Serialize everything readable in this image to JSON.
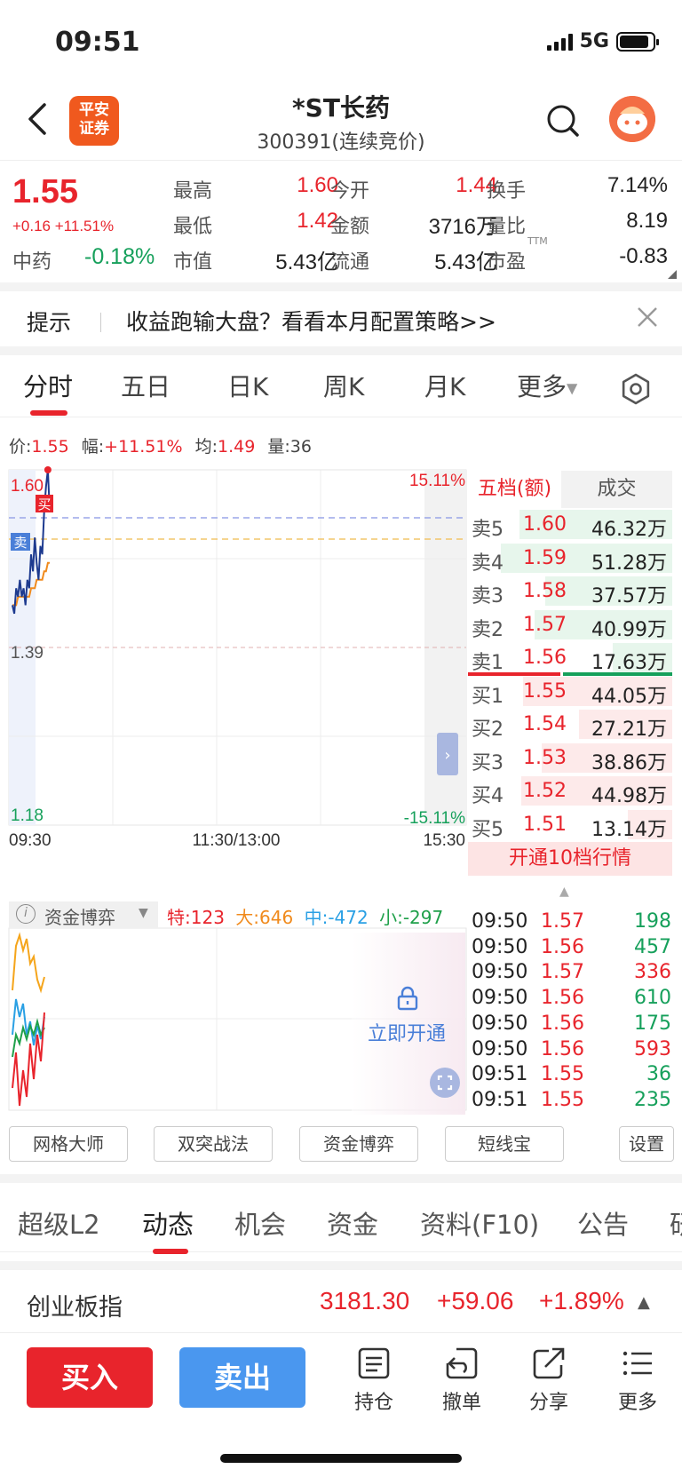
{
  "status_bar": {
    "time": "09:51",
    "network": "5G"
  },
  "header": {
    "broker_logo_line1": "平安",
    "broker_logo_line2": "证券",
    "stock_name": "*ST长药",
    "stock_code": "300391(连续竞价)"
  },
  "quote": {
    "price": "1.55",
    "change": "+0.16 +11.51%",
    "sector_name": "中药",
    "sector_change": "-0.18%",
    "fields": [
      {
        "label": "最高",
        "value": "1.60",
        "color": "red"
      },
      {
        "label": "今开",
        "value": "1.44",
        "color": "red"
      },
      {
        "label": "换手",
        "value": "7.14%",
        "color": "dark"
      },
      {
        "label": "最低",
        "value": "1.42",
        "color": "red"
      },
      {
        "label": "金额",
        "value": "3716万",
        "color": "dark"
      },
      {
        "label": "量比",
        "value": "8.19",
        "color": "dark"
      },
      {
        "label": "市值",
        "value": "5.43亿",
        "color": "dark"
      },
      {
        "label": "流通",
        "value": "5.43亿",
        "color": "dark"
      },
      {
        "label": "市盈",
        "value": "-0.83",
        "color": "dark",
        "sup": "TTM"
      }
    ]
  },
  "tip": {
    "label": "提示",
    "text": "收益跑输大盘？看看本月配置策略>>"
  },
  "chart_tabs": [
    "分时",
    "五日",
    "日K",
    "周K",
    "月K",
    "更多"
  ],
  "info_line": {
    "price_label": "价:",
    "price": "1.55",
    "range_label": "幅:",
    "range": "+11.51%",
    "avg_label": "均:",
    "avg": "1.49",
    "vol_label": "量:",
    "vol": "36"
  },
  "chart_data": {
    "type": "line",
    "y_labels_left": [
      "1.60",
      "1.39",
      "1.18"
    ],
    "y_labels_right": [
      "15.11%",
      "-15.11%"
    ],
    "x_labels": [
      "09:30",
      "11:30/13:00",
      "15:30"
    ],
    "ylim": [
      1.18,
      1.6
    ],
    "series": [
      {
        "name": "价",
        "color": "#1d3a8f",
        "x": [
          0,
          1,
          2,
          3,
          4,
          5,
          6,
          7,
          8,
          9,
          10,
          11,
          12,
          13,
          14,
          15,
          16,
          17,
          18,
          19,
          20
        ],
        "y": [
          1.44,
          1.43,
          1.46,
          1.45,
          1.47,
          1.45,
          1.46,
          1.44,
          1.47,
          1.46,
          1.5,
          1.48,
          1.52,
          1.49,
          1.47,
          1.51,
          1.5,
          1.55,
          1.58,
          1.6,
          1.55
        ]
      },
      {
        "name": "均",
        "color": "#f08a1c",
        "x": [
          0,
          1,
          2,
          3,
          4,
          5,
          6,
          7,
          8,
          9,
          10,
          11,
          12,
          13,
          14,
          15,
          16,
          17,
          18,
          19,
          20
        ],
        "y": [
          1.44,
          1.44,
          1.44,
          1.45,
          1.45,
          1.45,
          1.45,
          1.45,
          1.45,
          1.45,
          1.46,
          1.46,
          1.46,
          1.47,
          1.47,
          1.47,
          1.47,
          1.48,
          1.48,
          1.49,
          1.49
        ]
      }
    ],
    "markers": [
      {
        "label": "买"
      },
      {
        "label": "卖"
      }
    ]
  },
  "order_book": {
    "tabs": [
      "五档(额)",
      "成交"
    ],
    "asks": [
      {
        "label": "卖5",
        "price": "1.60",
        "amount": "46.32万",
        "bar": 0.82
      },
      {
        "label": "卖4",
        "price": "1.59",
        "amount": "51.28万",
        "bar": 0.92
      },
      {
        "label": "卖3",
        "price": "1.58",
        "amount": "37.57万",
        "bar": 0.68
      },
      {
        "label": "卖2",
        "price": "1.57",
        "amount": "40.99万",
        "bar": 0.74
      },
      {
        "label": "卖1",
        "price": "1.56",
        "amount": "17.63万",
        "bar": 0.32
      }
    ],
    "bids": [
      {
        "label": "买1",
        "price": "1.55",
        "amount": "44.05万",
        "bar": 0.8
      },
      {
        "label": "买2",
        "price": "1.54",
        "amount": "27.21万",
        "bar": 0.5
      },
      {
        "label": "买3",
        "price": "1.53",
        "amount": "38.86万",
        "bar": 0.7
      },
      {
        "label": "买4",
        "price": "1.52",
        "amount": "44.98万",
        "bar": 0.81
      },
      {
        "label": "买5",
        "price": "1.51",
        "amount": "13.14万",
        "bar": 0.24
      }
    ],
    "upgrade": "开通10档行情"
  },
  "fund_battle": {
    "title": "资金博弈",
    "te_label": "特:",
    "te": "123",
    "da_label": "大:",
    "da": "646",
    "zhong_label": "中:",
    "zhong": "-472",
    "xiao_label": "小:",
    "xiao": "-297",
    "lock_text": "立即开通"
  },
  "ticks": [
    {
      "time": "09:50",
      "price": "1.57",
      "vol": "198",
      "price_color": "red",
      "vol_color": "green"
    },
    {
      "time": "09:50",
      "price": "1.56",
      "vol": "457",
      "price_color": "red",
      "vol_color": "green"
    },
    {
      "time": "09:50",
      "price": "1.57",
      "vol": "336",
      "price_color": "red",
      "vol_color": "red"
    },
    {
      "time": "09:50",
      "price": "1.56",
      "vol": "610",
      "price_color": "red",
      "vol_color": "green"
    },
    {
      "time": "09:50",
      "price": "1.56",
      "vol": "175",
      "price_color": "red",
      "vol_color": "green"
    },
    {
      "time": "09:50",
      "price": "1.56",
      "vol": "593",
      "price_color": "red",
      "vol_color": "red"
    },
    {
      "time": "09:51",
      "price": "1.55",
      "vol": "36",
      "price_color": "red",
      "vol_color": "green"
    },
    {
      "time": "09:51",
      "price": "1.55",
      "vol": "235",
      "price_color": "red",
      "vol_color": "green"
    }
  ],
  "strategy_buttons": [
    "网格大师",
    "双突战法",
    "资金博弈",
    "短线宝",
    "设置"
  ],
  "info_tabs": [
    "超级L2",
    "动态",
    "机会",
    "资金",
    "资料(F10)",
    "公告",
    "研"
  ],
  "index_bar": {
    "name": "创业板指",
    "value": "3181.30",
    "change": "+59.06",
    "pct": "+1.89%"
  },
  "bottom_bar": {
    "buy": "买入",
    "sell": "卖出",
    "items": [
      {
        "label": "持仓",
        "icon": "position-icon"
      },
      {
        "label": "撤单",
        "icon": "cancel-order-icon"
      },
      {
        "label": "分享",
        "icon": "share-icon"
      },
      {
        "label": "更多",
        "icon": "more-icon"
      }
    ]
  },
  "colors": {
    "up": "#e8242c",
    "down": "#16a05b",
    "accent_blue": "#4a97ef",
    "broker_orange": "#f0591e"
  }
}
